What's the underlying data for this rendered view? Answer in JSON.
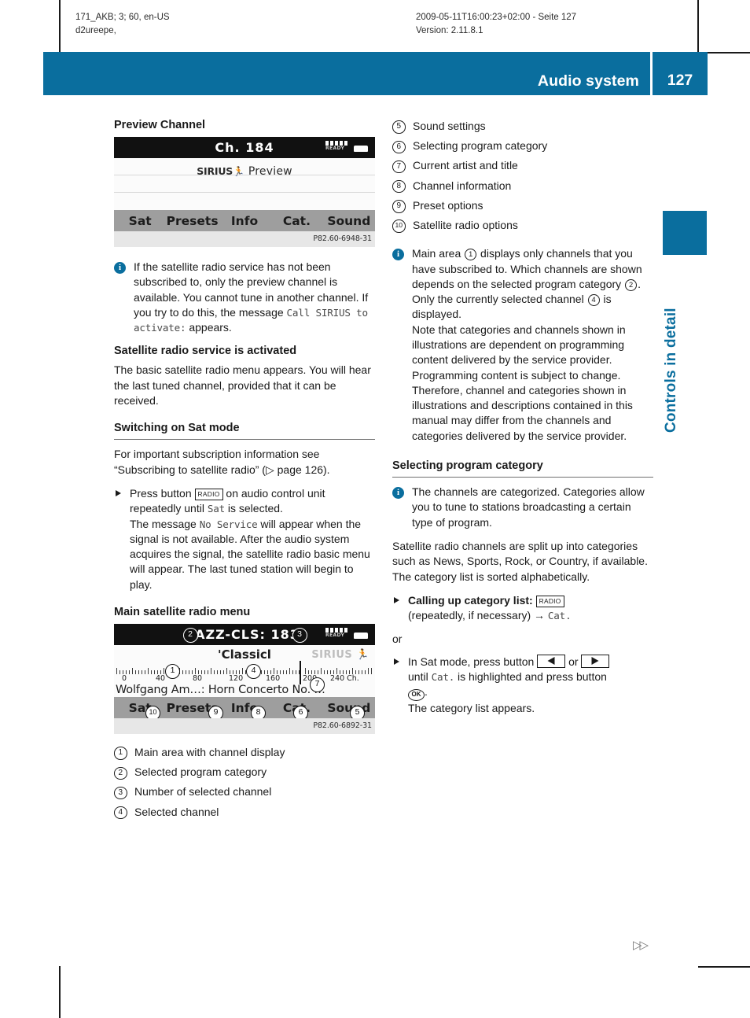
{
  "runhead": {
    "left_line1": "171_AKB; 3; 60, en-US",
    "left_line2": "d2ureepe,",
    "right_line1": "2009-05-11T16:00:23+02:00 - Seite 127",
    "right_line2": "Version: 2.11.8.1"
  },
  "header": {
    "title": "Audio system",
    "page_number": "127",
    "accent_color": "#0a6e9e"
  },
  "sidetab": {
    "label": "Controls in detail"
  },
  "left": {
    "preview_heading": "Preview Channel",
    "preview_figure": {
      "channel": "Ch. 184",
      "brand": "SIRIUS",
      "label": "Preview",
      "status": "READY",
      "menu": [
        "Sat",
        "Presets",
        "Info",
        "Cat.",
        "Sound"
      ],
      "caption": "P82.60-6948-31"
    },
    "note1": {
      "text_a": "If the satellite radio service has not been subscribed to, only the preview channel is available. You cannot tune in another channel. If you try to do this, the message ",
      "mono": "Call SIRIUS to activate:",
      "text_b": " appears."
    },
    "activated_heading": "Satellite radio service is activated",
    "activated_text": "The basic satellite radio menu appears. You will hear the last tuned channel, provided that it can be received.",
    "switching_heading": "Switching on Sat mode",
    "switching_text": "For important subscription information see “Subscribing to satellite radio” (▷ page 126).",
    "step1": {
      "lead": "Press button ",
      "key": "RADIO",
      "after_key": " on audio control unit repeatedly until ",
      "mono1": "Sat",
      "mid": " is selected.",
      "line2_a": "The message ",
      "mono2": "No Service",
      "line2_b": " will appear when the signal is not available. After the audio system acquires the signal, the satellite radio basic menu will appear. The last tuned station will begin to play."
    },
    "main_menu_heading": "Main satellite radio menu",
    "main_figure": {
      "category_channel": "JAZZ-CLS: 183",
      "selected_channel": "'Classicl",
      "brand": "SIRIUS",
      "status": "READY",
      "tick_labels": [
        "0",
        "40",
        "80",
        "120",
        "160",
        "200",
        "240 Ch."
      ],
      "artist_title": "Wolfgang Am…: Horn Concerto No. …",
      "menu": [
        "Sat",
        "Presets",
        "Info",
        "Cat.",
        "Sound"
      ],
      "callouts": [
        "1",
        "2",
        "3",
        "4",
        "5",
        "6",
        "7",
        "8",
        "9",
        "10"
      ],
      "caption": "P82.60-6892-31"
    },
    "legend": [
      {
        "num": "1",
        "label": "Main area with channel display"
      },
      {
        "num": "2",
        "label": "Selected program category"
      },
      {
        "num": "3",
        "label": "Number of selected channel"
      },
      {
        "num": "4",
        "label": "Selected channel"
      }
    ]
  },
  "right": {
    "legend": [
      {
        "num": "5",
        "label": "Sound settings"
      },
      {
        "num": "6",
        "label": "Selecting program category"
      },
      {
        "num": "7",
        "label": "Current artist and title"
      },
      {
        "num": "8",
        "label": "Channel information"
      },
      {
        "num": "9",
        "label": "Preset options"
      },
      {
        "num": "10",
        "label": "Satellite radio options"
      }
    ],
    "note_main_area": {
      "p1_a": "Main area ",
      "ref1": "1",
      "p1_b": " displays only channels that you have subscribed to. Which channels are shown depends on the selected program category ",
      "ref2": "2",
      "p1_c": ". Only the currently selected channel ",
      "ref3": "4",
      "p1_d": " is displayed.",
      "p2": "Note that categories and channels shown in illustrations are dependent on programming content delivered by the service provider. Programming content is subject to change.",
      "p3": "Therefore, channel and categories shown in illustrations and descriptions contained in this manual may differ from the channels and categories delivered by the service provider."
    },
    "category_heading": "Selecting program category",
    "category_note": "The channels are categorized. Categories allow you to tune to stations broadcasting a certain type of program.",
    "category_text": "Satellite radio channels are split up into categories such as News, Sports, Rock, or Country, if available. The category list is sorted alphabetically.",
    "step_call": {
      "bold": "Calling up category list:",
      "key": "RADIO",
      "line2_a": "(repeatedly, if necessary) ",
      "arrow": "→",
      "mono": "Cat."
    },
    "or_label": "or",
    "step_sat": {
      "lead": "In Sat mode, press button ",
      "or": " or ",
      "line2_a": "until ",
      "mono": "Cat.",
      "line2_b": " is highlighted and press button",
      "ok_key": "OK",
      "period": ".",
      "line3": "The category list appears."
    }
  },
  "continuation_marker": "▷▷"
}
